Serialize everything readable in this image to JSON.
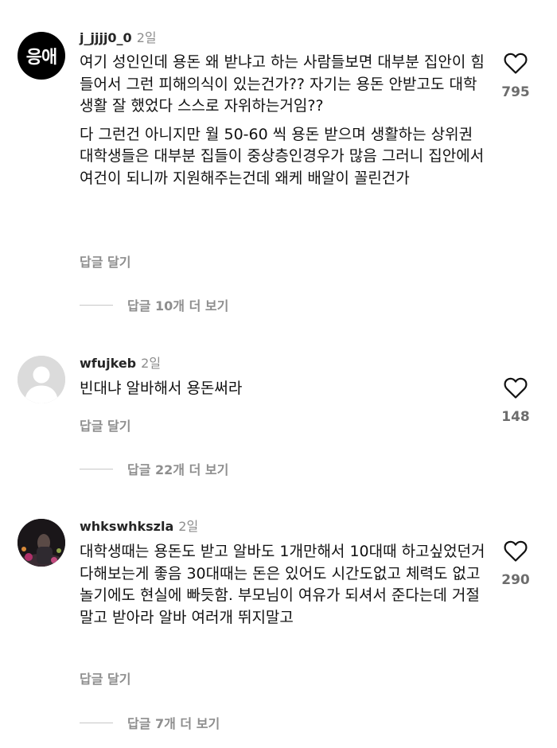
{
  "comments": [
    {
      "avatar_text": "응애",
      "username": "j_jjjj0_0",
      "time": "2일",
      "paragraphs": [
        "여기 성인인데 용돈 왜 받냐고 하는 사람들보면 대부분 집안이 힘들어서 그런 피해의식이 있는건가?? 자기는 용돈 안받고도 대학생활 잘 했었다 스스로 자위하는거임??",
        "다 그런건 아니지만 월 50-60 씩 용돈 받으며 생활하는 상위권 대학생들은 대부분 집들이 중상층인경우가 많음 그러니 집안에서 여건이 되니까 지원해주는건데 왜케 배알이 꼴린건가"
      ],
      "reply_label": "답글 달기",
      "view_replies": "답글 10개 더 보기",
      "likes": "795"
    },
    {
      "username": "wfujkeb",
      "time": "2일",
      "paragraphs": [
        "빈대냐 알바해서 용돈써라"
      ],
      "reply_label": "답글 달기",
      "view_replies": "답글 22개 더 보기",
      "likes": "148"
    },
    {
      "username": "whkswhkszla",
      "time": "2일",
      "paragraphs": [
        "대학생때는 용돈도 받고 알바도 1개만해서 10대때 하고싶었던거 다해보는게 좋음 30대때는 돈은 있어도 시간도없고 체력도 없고 놀기에도 현실에 빠듯함. 부모님이 여유가 되셔서 준다는데 거절말고 받아라 알바 여러개 뛰지말고"
      ],
      "reply_label": "답글 달기",
      "view_replies": "답글 7개 더 보기",
      "likes": "290"
    }
  ],
  "icons": {
    "like": "heart-outline-icon",
    "default_avatar": "default-profile-icon"
  },
  "colors": {
    "text": "#111111",
    "secondary": "#8e8e8e",
    "like_count": "#6d6d6d"
  }
}
